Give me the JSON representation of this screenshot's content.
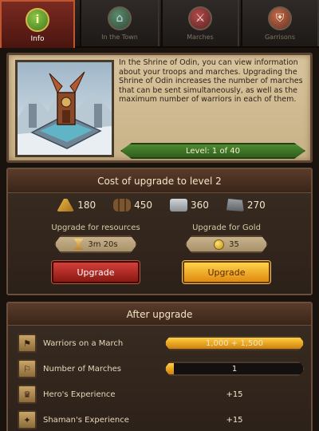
{
  "tabs": [
    {
      "label": "Info",
      "icon": "info-icon",
      "active": true
    },
    {
      "label": "In the Town",
      "icon": "town-icon",
      "active": false
    },
    {
      "label": "Marches",
      "icon": "marches-icon",
      "active": false
    },
    {
      "label": "Garrisons",
      "icon": "garrisons-icon",
      "active": false
    }
  ],
  "info": {
    "description": "In the Shrine of Odin, you can view information about your troops and marches. Upgrading the Shrine of Odin increases the number of marches that can be sent simultaneously, as well as the maximum number of warriors in each of them.",
    "level": "Level: 1 of 40"
  },
  "cost": {
    "title": "Cost of upgrade to level 2",
    "resources": [
      {
        "name": "wheat",
        "value": "180"
      },
      {
        "name": "wood",
        "value": "450"
      },
      {
        "name": "stone",
        "value": "360"
      },
      {
        "name": "iron",
        "value": "270"
      }
    ],
    "resources_option": {
      "title": "Upgrade for resources",
      "time": "3m 20s",
      "button": "Upgrade"
    },
    "gold_option": {
      "title": "Upgrade for Gold",
      "price": "35",
      "button": "Upgrade"
    }
  },
  "after": {
    "title": "After upgrade",
    "stats": [
      {
        "label": "Warriors on a March",
        "value": "1,000 + 1,500",
        "bar_fill": 1.0
      },
      {
        "label": "Number of Marches",
        "value": "1",
        "bar_fill": 0.06
      },
      {
        "label": "Hero's Experience",
        "value": "+15"
      },
      {
        "label": "Shaman's Experience",
        "value": "+15"
      }
    ]
  },
  "colors": {
    "accent_red": "#8a1814",
    "accent_gold": "#e08a10",
    "level_green": "#4e8b32"
  }
}
